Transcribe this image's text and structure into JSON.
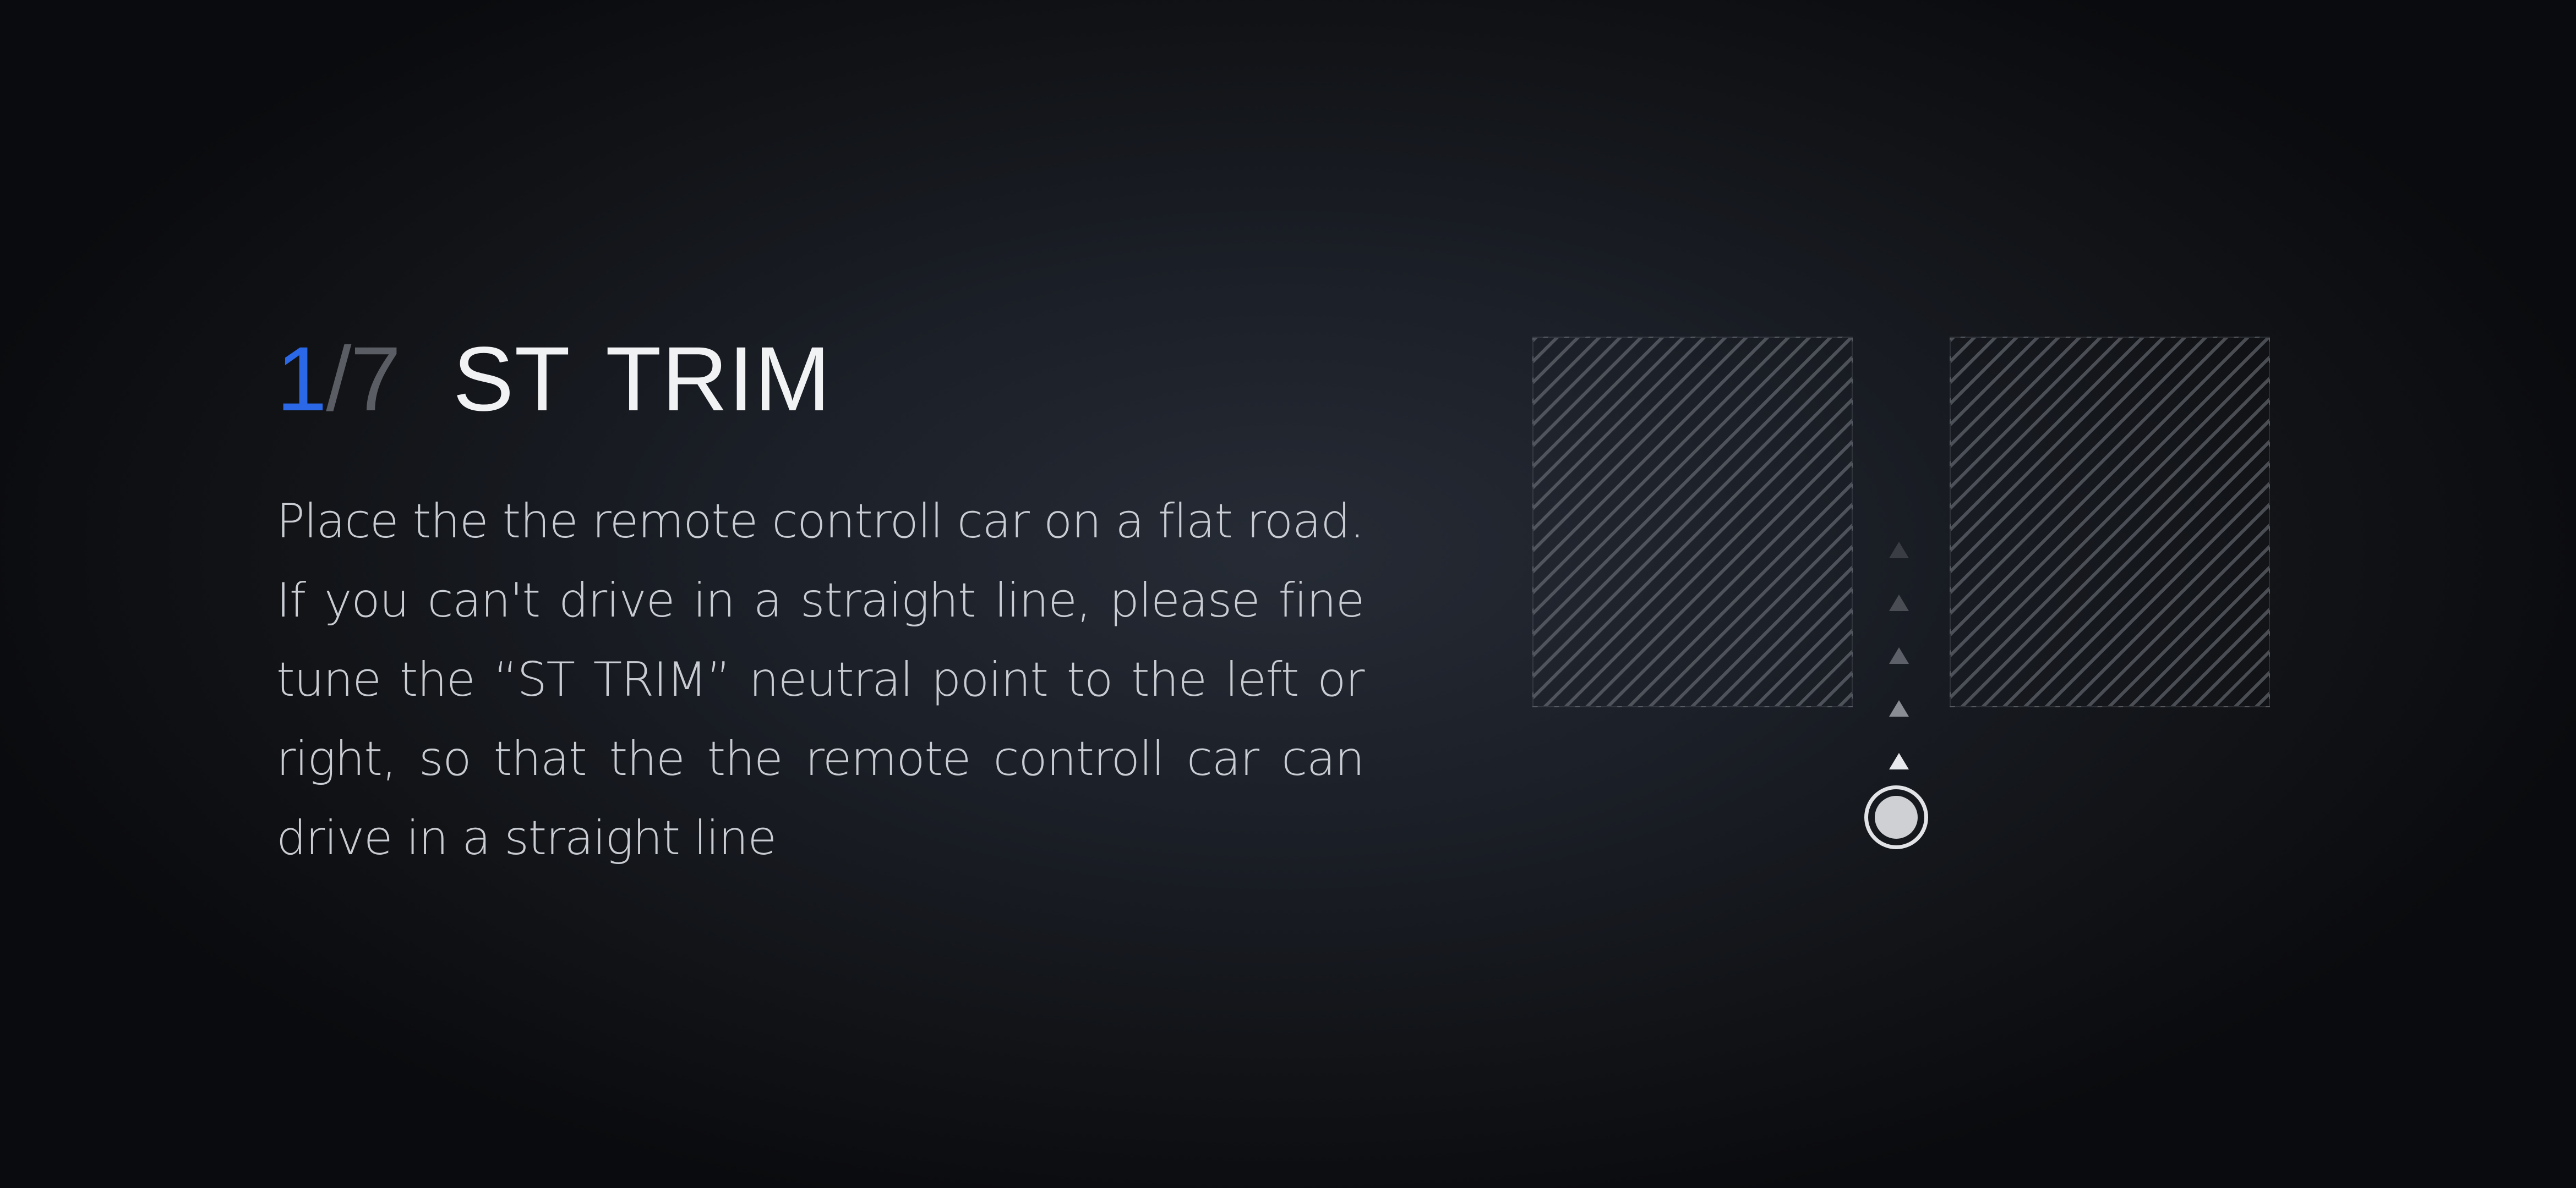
{
  "step": {
    "current": "1",
    "separator": "/",
    "total": "7",
    "title": "ST TRIM"
  },
  "description": "Place the the remote controll car on a flat road. If you can't drive in a straight line, please fine tune the “ST TRIM” neutral point to the left or right, so that the the remote controll car can drive in a straight line",
  "illustration": {
    "arrow_icon": "triangle-up-icon",
    "marker_icon": "car-position-dot-icon"
  },
  "colors": {
    "accent": "#2b68e8",
    "title": "#f1f2f4",
    "muted": "#5a5d63",
    "body_text": "#c9ccd2",
    "background": "#1b1f27"
  }
}
